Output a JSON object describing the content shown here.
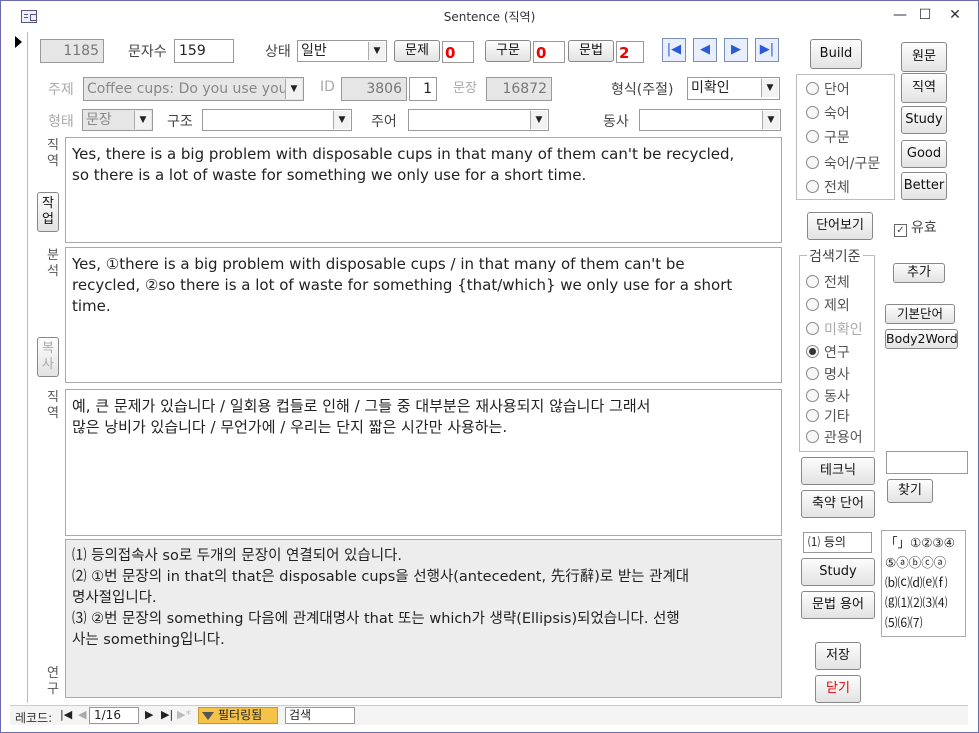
{
  "window": {
    "title": "Sentence (직역)",
    "min": "—",
    "max": "☐",
    "close": "✕"
  },
  "top": {
    "record_no": "1185",
    "char_count_label": "문자수",
    "char_count": "159",
    "status_label": "상태",
    "status_value": "일반",
    "problem_btn": "문제",
    "problem_val": "0",
    "phrase_btn": "구문",
    "phrase_val": "0",
    "grammar_btn": "문법",
    "grammar_val": "2",
    "build_btn": "Build",
    "original_btn": "원문",
    "literal_btn": "직역"
  },
  "row2": {
    "topic_label": "주제",
    "topic_value": "Coffee cups: Do you use you",
    "id_label": "ID",
    "id_value": "3806",
    "id_sub": "1",
    "sentence_label": "문장",
    "sentence_value": "16872",
    "format_label": "형식(주절)",
    "format_value": "미확인"
  },
  "row3": {
    "form_label": "형태",
    "form_value": "문장",
    "structure_label": "구조",
    "structure_value": "",
    "subject_label": "주어",
    "subject_value": "",
    "verb_label": "동사",
    "verb_value": ""
  },
  "sections": {
    "literal_label": "직역",
    "work_btn": "작업",
    "analysis_label": "분석",
    "copy_btn": "복사",
    "literal2_label": "직역",
    "research_label": "연구"
  },
  "texts": {
    "english": "Yes, there is a big problem with disposable cups in that many of them can't be recycled,\nso there is a lot of waste for something we only use for a short time.",
    "analysis": "Yes, ①there is a big problem with disposable cups / in that many of them can't be\nrecycled, ②so there is a lot of waste for something {that/which} we only use for a short\ntime.",
    "korean": "예, 큰 문제가 있습니다 / 일회용 컵들로 인해 / 그들 중 대부분은 재사용되지 않습니다 그래서\n많은 낭비가 있습니다 / 무언가에 / 우리는 단지 짧은 시간만 사용하는.",
    "research": "⑴ 등의접속사 so로 두개의 문장이 연결되어 있습니다.\n⑵ ①번 문장의 in that의 that은 disposable cups을 선행사(antecedent, 先行辭)로 받는 관계대\n명사절입니다.\n⑶ ②번 문장의 something 다음에 관계대명사 that 또는 which가 생략(Ellipsis)되었습니다. 선행\n사는 something입니다."
  },
  "word_group": {
    "options": [
      "단어",
      "숙어",
      "구문",
      "숙어/구문",
      "전체"
    ]
  },
  "side_buttons": [
    "Study",
    "Good",
    "Better"
  ],
  "word_view_btn": "단어보기",
  "valid": {
    "label": "유효",
    "checked": "✓"
  },
  "search_group": {
    "title": "검색기준",
    "options": [
      "전체",
      "제외",
      "미확인",
      "연구",
      "명사",
      "동사",
      "기타",
      "관용어"
    ],
    "selected": "연구"
  },
  "add_btn": "추가",
  "basic_word_btn": "기본단어",
  "body2word_btn": "Body2Word",
  "technique_btn": "테크닉",
  "abbr_btn": "축약 단어",
  "find_btn": "찾기",
  "find_input": "",
  "etc_field": "⑴ 등의",
  "study_btn2": "Study",
  "grammar_term_btn": "문법 용어",
  "symbols": "「」①②③④\n⑤ⓐⓑⓒⓐ\n⒝⒞⒟⒠⒡\n⒢⑴⑵⑶⑷\n⑸⑹⑺",
  "save_btn": "저장",
  "close_btn": "닫기",
  "status": {
    "record_label": "레코드:",
    "record_value": "1/16",
    "filter_label": "필터링됨",
    "search_placeholder": "검색"
  },
  "colors": {
    "accent_red": "#e00000",
    "nav_blue": "#2a5bd7"
  }
}
